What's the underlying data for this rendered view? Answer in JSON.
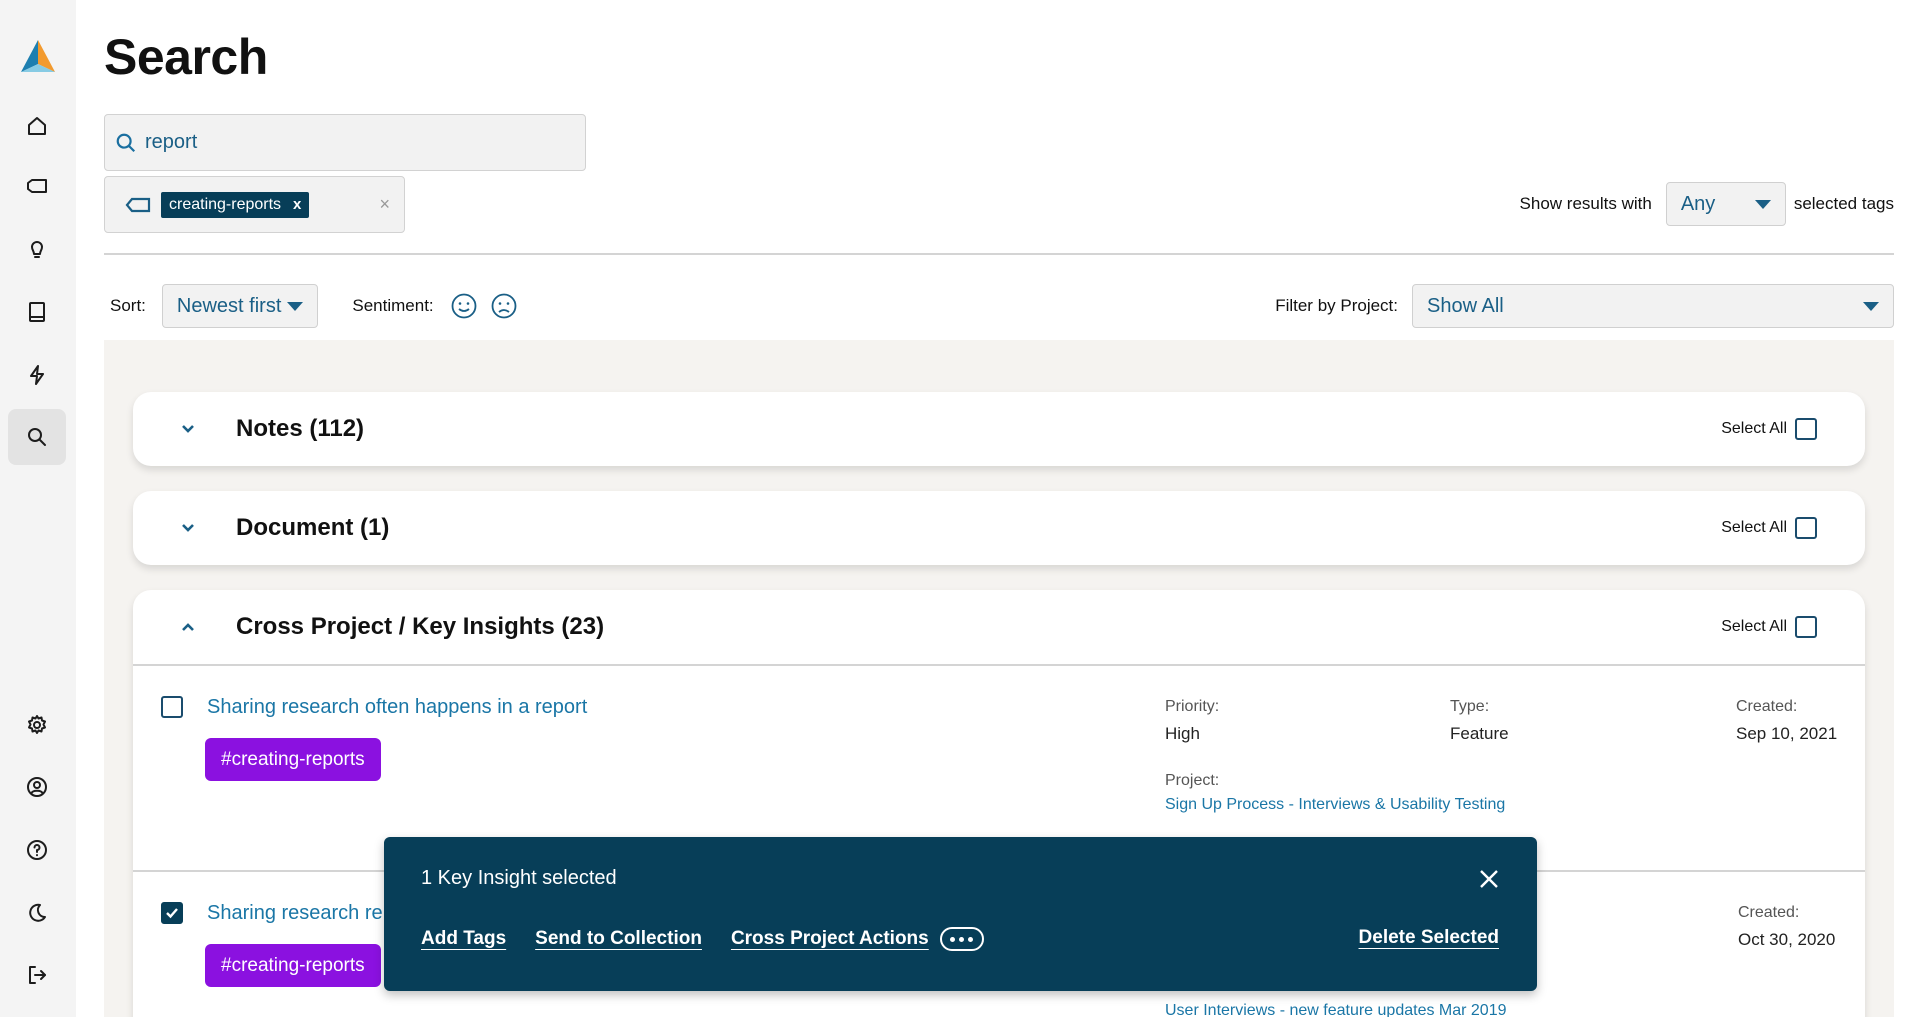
{
  "sidebar": {
    "items": [
      {
        "icon": "home-icon"
      },
      {
        "icon": "tag-icon"
      },
      {
        "icon": "lightbulb-icon"
      },
      {
        "icon": "book-icon"
      },
      {
        "icon": "bolt-icon"
      },
      {
        "icon": "search-icon",
        "active": true
      },
      {
        "icon": "gear-icon"
      },
      {
        "icon": "user-icon"
      },
      {
        "icon": "help-icon"
      },
      {
        "icon": "moon-icon"
      },
      {
        "icon": "logout-icon"
      }
    ]
  },
  "page": {
    "title": "Search"
  },
  "search": {
    "value": "report"
  },
  "tags": {
    "selected": "creating-reports",
    "remove": "x",
    "clear": "×"
  },
  "show_results": {
    "prefix": "Show results with",
    "value": "Any",
    "suffix": "selected tags"
  },
  "sort": {
    "label": "Sort:",
    "value": "Newest first"
  },
  "sentiment": {
    "label": "Sentiment:"
  },
  "filter": {
    "label": "Filter by Project:",
    "value": "Show All"
  },
  "sections": [
    {
      "title": "Notes (112)",
      "select_all": "Select All",
      "expanded": false
    },
    {
      "title": "Document (1)",
      "select_all": "Select All",
      "expanded": false
    },
    {
      "title": "Cross Project / Key Insights (23)",
      "select_all": "Select All",
      "expanded": true
    }
  ],
  "insights": [
    {
      "title": "Sharing research often happens in a report",
      "tag": "#creating-reports",
      "priority_label": "Priority:",
      "priority": "High",
      "type_label": "Type:",
      "type": "Feature",
      "created_label": "Created:",
      "created": "Sep 10, 2021",
      "project_label": "Project:",
      "project": "Sign Up Process - Interviews & Usability Testing",
      "checked": false
    },
    {
      "title": "Sharing research re",
      "tag": "#creating-reports",
      "created_label": "Created:",
      "created": "Oct 30, 2020",
      "project": "User Interviews - new feature updates Mar 2019",
      "checked": true
    }
  ],
  "selection_bar": {
    "text": "1 Key Insight selected",
    "add_tags": "Add Tags",
    "send_to_collection": "Send to Collection",
    "cross_project_actions": "Cross Project Actions",
    "delete_selected": "Delete Selected"
  },
  "colors": {
    "accent": "#073e58",
    "link": "#1a76a6",
    "hashtag": "#8b11e0"
  }
}
